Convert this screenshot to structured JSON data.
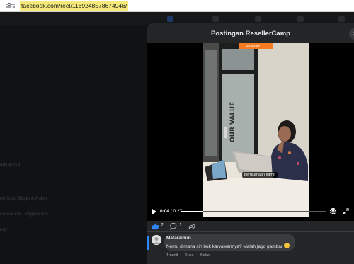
{
  "browser": {
    "url": "facebook.com/reel/1169248578674946/"
  },
  "sidebar": {
    "items": [
      {
        "label": "agkapnya"
      },
      {
        "label": "ne Slots Bingo & Poker"
      },
      {
        "label": "en Casino - VegasSlots"
      },
      {
        "label": "ndy"
      }
    ]
  },
  "modal": {
    "title": "Postingan ResellerCamp",
    "close_glyph": "✕"
  },
  "video": {
    "caption": "perusahaan kami!",
    "watermark": "Reseller",
    "wall_text": "OUR VALUE",
    "progress": 0.15
  },
  "controls": {
    "current_time": "0:04",
    "separator": " / ",
    "duration": "0:27"
  },
  "engagement": {
    "likes": "2",
    "comments": "1"
  },
  "comment": {
    "author": "Mataraibun",
    "text": "Nemu dimana sih buk karyawannya? Malah jago gambar",
    "emoji": "grinning-sweat-emoji",
    "actions": [
      "1menit",
      "Suka",
      "Balas"
    ]
  },
  "colors": {
    "accent": "#2d88ff",
    "modal_bg": "#242526",
    "bubble_bg": "#3a3b3c",
    "url_highlight": "#f5e97a"
  }
}
